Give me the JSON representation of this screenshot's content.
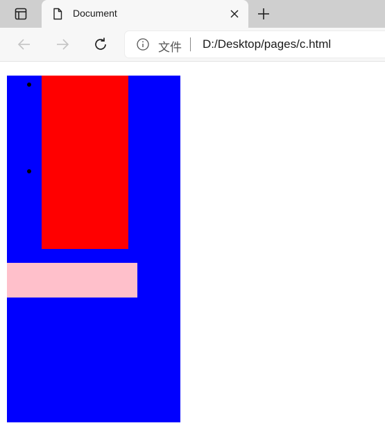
{
  "browser": {
    "tab": {
      "title": "Document"
    },
    "address_bar": {
      "site_label": "文件",
      "url": "D:/Desktop/pages/c.html"
    }
  },
  "page": {
    "colors": {
      "container": "#0000ff",
      "list_item": "#ff0000",
      "block": "#ffc0cb",
      "bullet": "#000000"
    },
    "list_bullets": 2
  }
}
